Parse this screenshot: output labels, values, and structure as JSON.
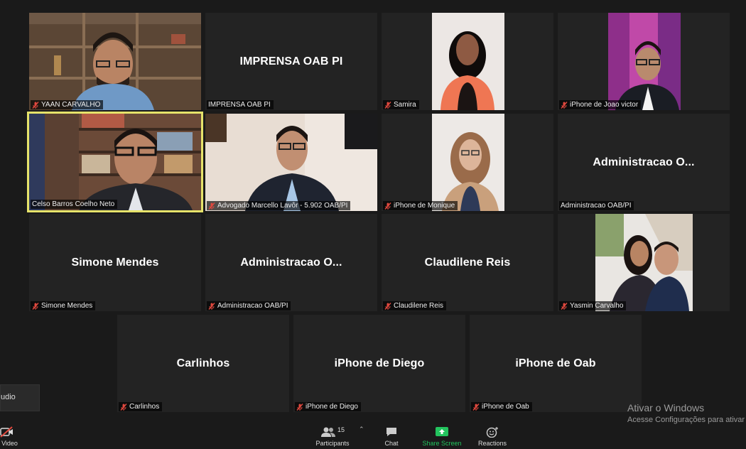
{
  "tiles": [
    {
      "name": "YAAN CARVALHO",
      "display": ""
    },
    {
      "name": "IMPRENSA OAB PI",
      "display": "IMPRENSA OAB PI"
    },
    {
      "name": "Samira",
      "display": ""
    },
    {
      "name": "iPhone de Joao victor",
      "display": ""
    },
    {
      "name": "Celso Barros Coelho Neto",
      "display": ""
    },
    {
      "name": "Advogado Marcello Lavôr - 5.902 OAB/PI",
      "display": ""
    },
    {
      "name": "iPhone de Monique",
      "display": ""
    },
    {
      "name": "Administracao OAB/PI",
      "display": "Administracao O..."
    },
    {
      "name": "Simone Mendes",
      "display": "Simone Mendes"
    },
    {
      "name": "Administracao OAB/PI",
      "display": "Administracao O..."
    },
    {
      "name": "Claudilene Reis",
      "display": "Claudilene Reis"
    },
    {
      "name": "Yasmin Carvalho",
      "display": ""
    },
    {
      "name": "Carlinhos",
      "display": "Carlinhos"
    },
    {
      "name": "iPhone de Diego",
      "display": "iPhone de Diego"
    },
    {
      "name": "iPhone de Oab",
      "display": "iPhone de Oab"
    }
  ],
  "toolbar": {
    "audio_label": "udio",
    "video_label": "t Video",
    "participants_label": "Participants",
    "participants_count": "15",
    "chat_label": "Chat",
    "share_label": "Share Screen",
    "reactions_label": "Reactions"
  },
  "watermark": {
    "line1": "Ativar o Windows",
    "line2": "Acesse Configurações para ativar"
  },
  "colors": {
    "background": "#1a1a1a",
    "tile": "#232323",
    "active_border": "#e6e36a",
    "share_green": "#23c45e",
    "muted_red": "#e0483e"
  }
}
